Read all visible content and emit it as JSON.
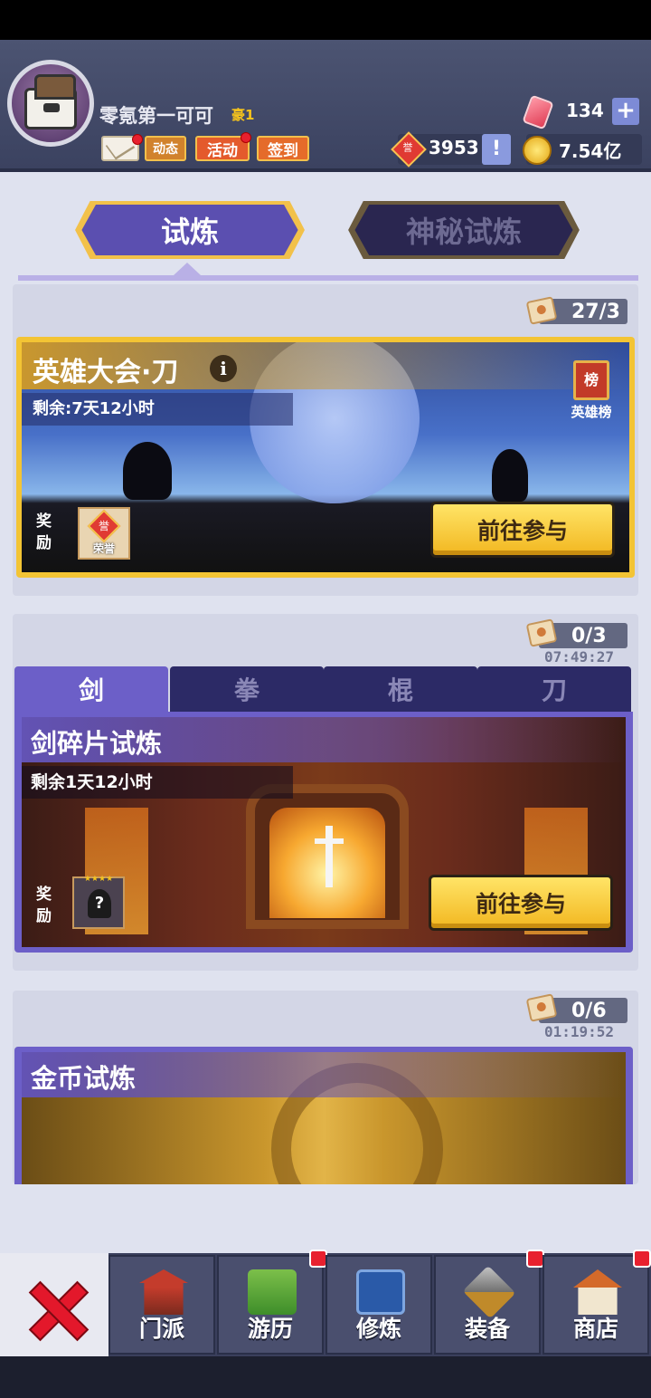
{
  "header": {
    "player_name": "零氪第一可可",
    "vip_label": "豪1",
    "news_label": "动态",
    "activity_label": "活动",
    "signin_label": "签到",
    "gems": "134",
    "gems_plus": "+",
    "honor_icon_text": "誉",
    "honor_points": "3953",
    "info_mark": "!",
    "gold": "7.54亿"
  },
  "tabs": {
    "trial": "试炼",
    "mystery_trial": "神秘试炼"
  },
  "hero_event": {
    "attempts": "27/3",
    "title": "英雄大会·刀",
    "info_mark": "i",
    "remaining": "剩余:7天12小时",
    "ranking_banner": "榜",
    "ranking_label": "英雄榜",
    "reward_label": "奖励",
    "reward_badge": "誉",
    "reward_item": "荣誉",
    "go_button": "前往参与"
  },
  "weapon_trial": {
    "attempts": "0/3",
    "timer": "07:49:27",
    "tabs": [
      "剑",
      "拳",
      "棍",
      "刀"
    ],
    "title": "剑碎片试炼",
    "remaining": "剩余1天12小时",
    "reward_label": "奖励",
    "reward_stars": "★★★★",
    "reward_mark": "?",
    "go_button": "前往参与"
  },
  "gold_trial": {
    "attempts": "0/6",
    "timer": "01:19:52",
    "title": "金币试炼"
  },
  "nav": {
    "items": [
      "门派",
      "游历",
      "修炼",
      "装备",
      "商店"
    ]
  },
  "colors": {
    "accent_purple": "#6c5fc8",
    "button_yellow": "#f2b720",
    "alert_red": "#e8202e"
  }
}
